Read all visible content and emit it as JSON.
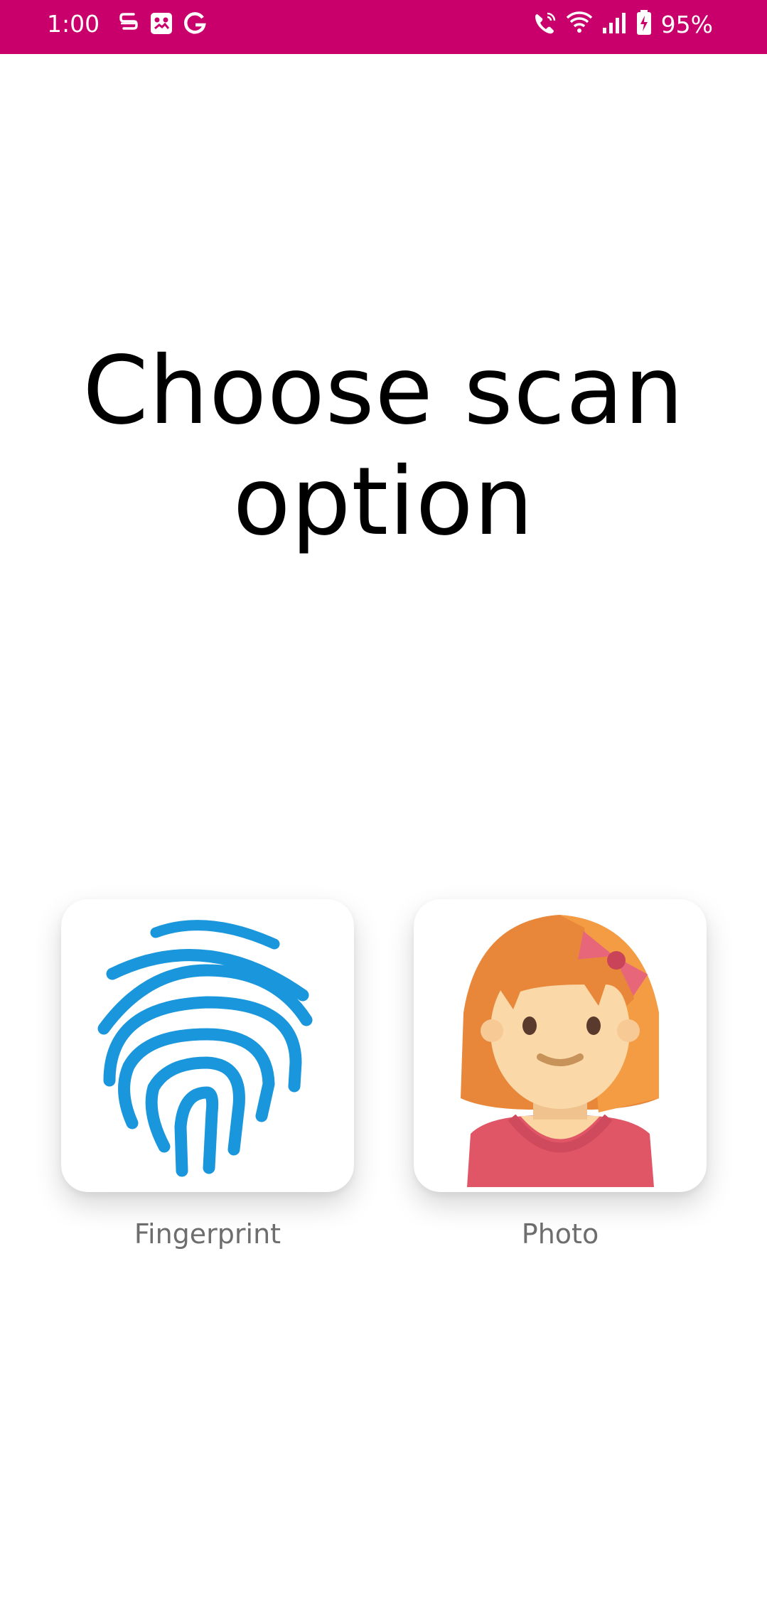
{
  "status_bar": {
    "time": "1:00",
    "battery_percent": "95%",
    "background_color": "#c9006b",
    "left_icons": [
      "notification-s-icon",
      "gallery-icon",
      "google-icon"
    ],
    "right_icons": [
      "wifi-calling-icon",
      "wifi-icon",
      "signal-icon",
      "battery-charging-icon"
    ]
  },
  "main": {
    "title": "Choose scan option",
    "options": [
      {
        "label": "Fingerprint",
        "icon": "fingerprint-icon",
        "accent": "#1a96dc"
      },
      {
        "label": "Photo",
        "icon": "girl-avatar-icon",
        "accent": "#f0913b"
      }
    ]
  }
}
